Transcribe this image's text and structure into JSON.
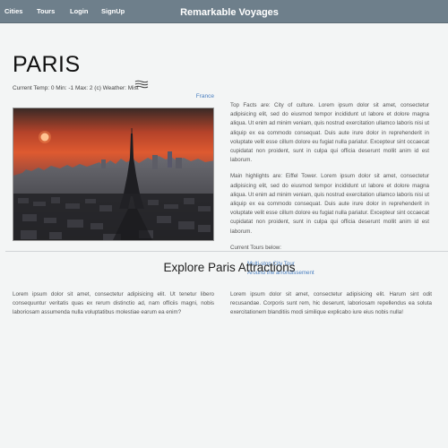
{
  "nav": {
    "items": [
      {
        "label": "Cities"
      },
      {
        "label": "Tours"
      },
      {
        "label": "Login"
      },
      {
        "label": "SignUp"
      }
    ],
    "brand": "Remarkable Voyages"
  },
  "city": {
    "name": "PARIS",
    "weather": "Current Temp: 0 Min: -1 Max: 2 (c) Weather: Mist",
    "weather_icon": "mist-icon",
    "country_link": "France"
  },
  "hero_image": {
    "description_icon": "eiffel-tower-sunset-photo"
  },
  "facts": {
    "top_facts": "Top Facts are: City of culture. Lorem ipsum dolor sit amet, consectetur adipisicing elit, sed do eiusmod tempor incididunt ut labore et dolore magna aliqua. Ut enim ad minim veniam, quis nostrud exercitation ullamco laboris nisi ut aliquip ex ea commodo consequat. Duis aute irure dolor in reprehenderit in voluptate velit esse cillum dolore eu fugiat nulla pariatur. Excepteur sint occaecat cupidatat non proident, sunt in culpa qui officia deserunt mollit anim id est laborum.",
    "main_highlights": "Main highlights are: Eiffel Tower. Lorem ipsum dolor sit amet, consectetur adipisicing elit, sed do eiusmod tempor incididunt ut labore et dolore magna aliqua. Ut enim ad minim veniam, quis nostrud exercitation ullamco laboris nisi ut aliquip ex ea commodo consequat. Duis aute irure dolor in reprehenderit in voluptate velit esse cillum dolore eu fugiat nulla pariatur. Excepteur sint occaecat cupidatat non proident, sunt in culpa qui officia deserunt mollit anim id est laborum.",
    "tours_label": "Current Tours below:",
    "tours": [
      "Multi-stop City Tour",
      "Around the arrondissement"
    ]
  },
  "attractions": {
    "title": "Explore Paris Attractions",
    "left_text": "Lorem ipsum dolor sit amet, consectetur adipisicing elit. Ut tenetur libero consequuntur veritatis quas ex rerum distinctio ad, nam officiis magni, nobis laboriosam assumenda nulla voluptatibus molestiae earum ea enim?",
    "right_text": "Lorem ipsum dolor sit amet, consectetur adipisicing elit. Harum sint odit recusandae. Corporis sunt rem, hic deserunt, laboriosam repellendus ea soluta exercitationem blanditiis modi similique explicabo iure eius nobis nulla!"
  },
  "colors": {
    "navbar": "#6e7f8b",
    "link": "#4a7fc0",
    "background": "#f3f5f5"
  }
}
